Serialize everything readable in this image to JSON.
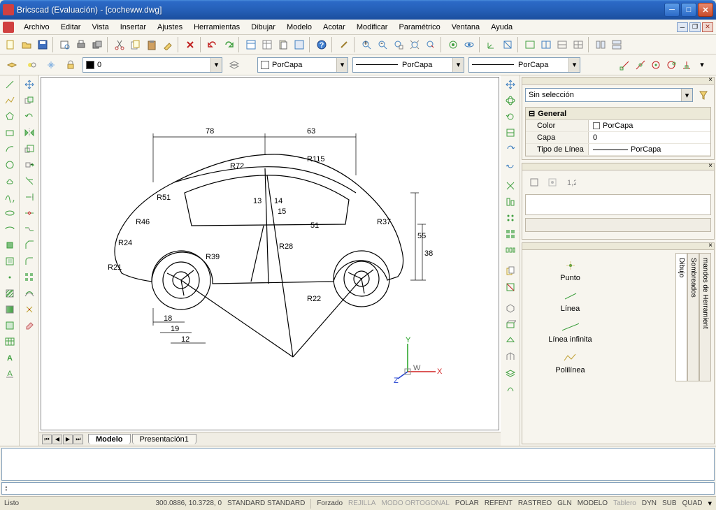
{
  "window": {
    "title": "Bricscad (Evaluación) - [cocheww.dwg]"
  },
  "menu": {
    "items": [
      "Archivo",
      "Editar",
      "Vista",
      "Insertar",
      "Ajustes",
      "Herramientas",
      "Dibujar",
      "Modelo",
      "Acotar",
      "Modificar",
      "Paramétrico",
      "Ventana",
      "Ayuda"
    ]
  },
  "layer": {
    "current": "0"
  },
  "linestyle": {
    "bylayer": "PorCapa"
  },
  "tabs": {
    "model": "Modelo",
    "layout1": "Presentación1"
  },
  "selection": {
    "none": "Sin selección"
  },
  "props": {
    "group": "General",
    "rows": [
      {
        "k": "Color",
        "v": "PorCapa"
      },
      {
        "k": "Capa",
        "v": "0"
      },
      {
        "k": "Tipo de Línea",
        "v": "PorCapa"
      }
    ]
  },
  "palette": {
    "items": [
      "Punto",
      "Línea",
      "Línea infinita",
      "Polilínea"
    ],
    "tabs": [
      "mandos de Herramient",
      "Sombreados",
      "Dibujo"
    ]
  },
  "dims": {
    "d78": "78",
    "d63": "63",
    "r115": "R115",
    "r72": "R72",
    "r51": "R51",
    "r46": "R46",
    "r24": "R24",
    "r21": "R21",
    "r39": "R39",
    "r28": "R28",
    "r37": "R37",
    "r22": "R22",
    "d13": "13",
    "d14": "14",
    "d15": "15",
    "d18": "18",
    "d19": "19",
    "d12": "12",
    "d55": "55",
    "d38": "38",
    "d51": "51"
  },
  "ucs": {
    "x": "X",
    "y": "Y",
    "z": "Z",
    "w": "W"
  },
  "cmd": {
    "prompt": ":"
  },
  "status": {
    "ready": "Listo",
    "coords": "300.0886, 10.3728, 0",
    "std": "STANDARD STANDARD",
    "items": [
      "Forzado",
      "REJILLA",
      "MODO ORTOGONAL",
      "POLAR",
      "REFENT",
      "RASTREO",
      "GLN",
      "MODELO",
      "Tablero",
      "DYN",
      "SUB",
      "QUAD"
    ],
    "dim": [
      false,
      true,
      true,
      false,
      false,
      false,
      false,
      false,
      true,
      false,
      false,
      false
    ]
  }
}
